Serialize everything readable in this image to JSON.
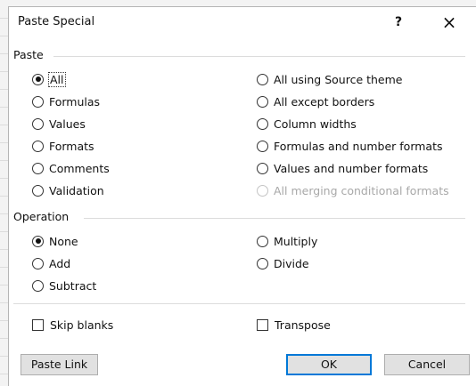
{
  "dialog": {
    "title": "Paste Special",
    "help_label": "?",
    "close_label": "×"
  },
  "paste": {
    "label": "Paste",
    "left_options": [
      {
        "label": "All",
        "selected": true
      },
      {
        "label": "Formulas"
      },
      {
        "label": "Values"
      },
      {
        "label": "Formats"
      },
      {
        "label": "Comments"
      },
      {
        "label": "Validation"
      }
    ],
    "right_options": [
      {
        "label": "All using Source theme"
      },
      {
        "label": "All except borders"
      },
      {
        "label": "Column widths"
      },
      {
        "label": "Formulas and number formats"
      },
      {
        "label": "Values and number formats"
      },
      {
        "label": "All merging conditional formats",
        "disabled": true
      }
    ]
  },
  "operation": {
    "label": "Operation",
    "options": [
      {
        "label": "None",
        "selected": true
      },
      {
        "label": "Multiply"
      },
      {
        "label": "Add"
      },
      {
        "label": "Divide"
      },
      {
        "label": "Subtract"
      }
    ]
  },
  "checkboxes": {
    "skip_blanks": {
      "label": "Skip blanks",
      "checked": false
    },
    "transpose": {
      "label": "Transpose",
      "checked": false
    }
  },
  "buttons": {
    "paste_link": "Paste Link",
    "ok": "OK",
    "cancel": "Cancel"
  }
}
